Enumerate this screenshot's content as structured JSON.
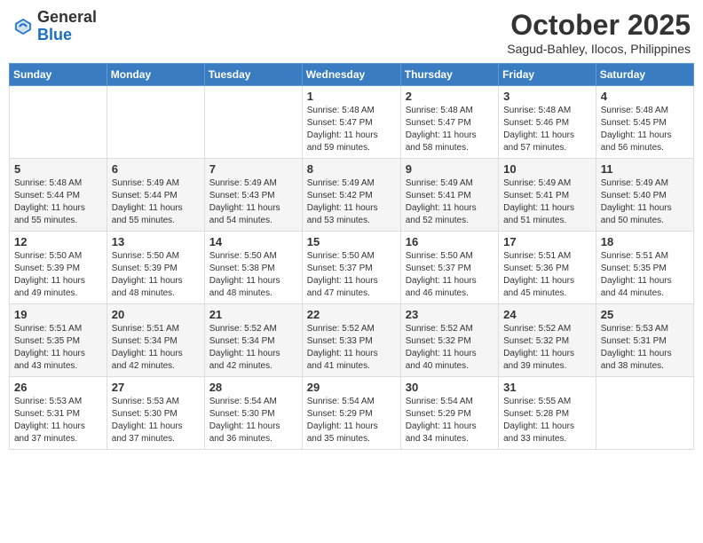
{
  "header": {
    "logo_general": "General",
    "logo_blue": "Blue",
    "month_title": "October 2025",
    "location": "Sagud-Bahley, Ilocos, Philippines"
  },
  "weekdays": [
    "Sunday",
    "Monday",
    "Tuesday",
    "Wednesday",
    "Thursday",
    "Friday",
    "Saturday"
  ],
  "weeks": [
    [
      {
        "day": "",
        "info": ""
      },
      {
        "day": "",
        "info": ""
      },
      {
        "day": "",
        "info": ""
      },
      {
        "day": "1",
        "info": "Sunrise: 5:48 AM\nSunset: 5:47 PM\nDaylight: 11 hours\nand 59 minutes."
      },
      {
        "day": "2",
        "info": "Sunrise: 5:48 AM\nSunset: 5:47 PM\nDaylight: 11 hours\nand 58 minutes."
      },
      {
        "day": "3",
        "info": "Sunrise: 5:48 AM\nSunset: 5:46 PM\nDaylight: 11 hours\nand 57 minutes."
      },
      {
        "day": "4",
        "info": "Sunrise: 5:48 AM\nSunset: 5:45 PM\nDaylight: 11 hours\nand 56 minutes."
      }
    ],
    [
      {
        "day": "5",
        "info": "Sunrise: 5:48 AM\nSunset: 5:44 PM\nDaylight: 11 hours\nand 55 minutes."
      },
      {
        "day": "6",
        "info": "Sunrise: 5:49 AM\nSunset: 5:44 PM\nDaylight: 11 hours\nand 55 minutes."
      },
      {
        "day": "7",
        "info": "Sunrise: 5:49 AM\nSunset: 5:43 PM\nDaylight: 11 hours\nand 54 minutes."
      },
      {
        "day": "8",
        "info": "Sunrise: 5:49 AM\nSunset: 5:42 PM\nDaylight: 11 hours\nand 53 minutes."
      },
      {
        "day": "9",
        "info": "Sunrise: 5:49 AM\nSunset: 5:41 PM\nDaylight: 11 hours\nand 52 minutes."
      },
      {
        "day": "10",
        "info": "Sunrise: 5:49 AM\nSunset: 5:41 PM\nDaylight: 11 hours\nand 51 minutes."
      },
      {
        "day": "11",
        "info": "Sunrise: 5:49 AM\nSunset: 5:40 PM\nDaylight: 11 hours\nand 50 minutes."
      }
    ],
    [
      {
        "day": "12",
        "info": "Sunrise: 5:50 AM\nSunset: 5:39 PM\nDaylight: 11 hours\nand 49 minutes."
      },
      {
        "day": "13",
        "info": "Sunrise: 5:50 AM\nSunset: 5:39 PM\nDaylight: 11 hours\nand 48 minutes."
      },
      {
        "day": "14",
        "info": "Sunrise: 5:50 AM\nSunset: 5:38 PM\nDaylight: 11 hours\nand 48 minutes."
      },
      {
        "day": "15",
        "info": "Sunrise: 5:50 AM\nSunset: 5:37 PM\nDaylight: 11 hours\nand 47 minutes."
      },
      {
        "day": "16",
        "info": "Sunrise: 5:50 AM\nSunset: 5:37 PM\nDaylight: 11 hours\nand 46 minutes."
      },
      {
        "day": "17",
        "info": "Sunrise: 5:51 AM\nSunset: 5:36 PM\nDaylight: 11 hours\nand 45 minutes."
      },
      {
        "day": "18",
        "info": "Sunrise: 5:51 AM\nSunset: 5:35 PM\nDaylight: 11 hours\nand 44 minutes."
      }
    ],
    [
      {
        "day": "19",
        "info": "Sunrise: 5:51 AM\nSunset: 5:35 PM\nDaylight: 11 hours\nand 43 minutes."
      },
      {
        "day": "20",
        "info": "Sunrise: 5:51 AM\nSunset: 5:34 PM\nDaylight: 11 hours\nand 42 minutes."
      },
      {
        "day": "21",
        "info": "Sunrise: 5:52 AM\nSunset: 5:34 PM\nDaylight: 11 hours\nand 42 minutes."
      },
      {
        "day": "22",
        "info": "Sunrise: 5:52 AM\nSunset: 5:33 PM\nDaylight: 11 hours\nand 41 minutes."
      },
      {
        "day": "23",
        "info": "Sunrise: 5:52 AM\nSunset: 5:32 PM\nDaylight: 11 hours\nand 40 minutes."
      },
      {
        "day": "24",
        "info": "Sunrise: 5:52 AM\nSunset: 5:32 PM\nDaylight: 11 hours\nand 39 minutes."
      },
      {
        "day": "25",
        "info": "Sunrise: 5:53 AM\nSunset: 5:31 PM\nDaylight: 11 hours\nand 38 minutes."
      }
    ],
    [
      {
        "day": "26",
        "info": "Sunrise: 5:53 AM\nSunset: 5:31 PM\nDaylight: 11 hours\nand 37 minutes."
      },
      {
        "day": "27",
        "info": "Sunrise: 5:53 AM\nSunset: 5:30 PM\nDaylight: 11 hours\nand 37 minutes."
      },
      {
        "day": "28",
        "info": "Sunrise: 5:54 AM\nSunset: 5:30 PM\nDaylight: 11 hours\nand 36 minutes."
      },
      {
        "day": "29",
        "info": "Sunrise: 5:54 AM\nSunset: 5:29 PM\nDaylight: 11 hours\nand 35 minutes."
      },
      {
        "day": "30",
        "info": "Sunrise: 5:54 AM\nSunset: 5:29 PM\nDaylight: 11 hours\nand 34 minutes."
      },
      {
        "day": "31",
        "info": "Sunrise: 5:55 AM\nSunset: 5:28 PM\nDaylight: 11 hours\nand 33 minutes."
      },
      {
        "day": "",
        "info": ""
      }
    ]
  ]
}
